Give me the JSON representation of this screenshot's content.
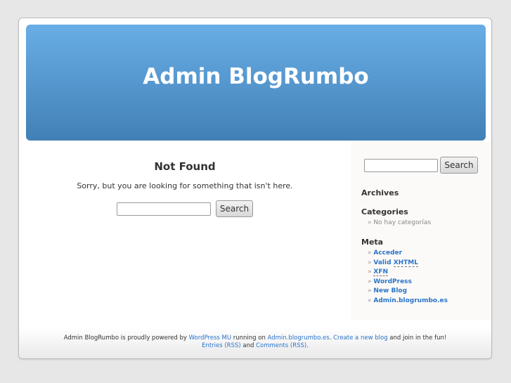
{
  "header": {
    "title": "Admin BlogRumbo"
  },
  "content": {
    "heading": "Not Found",
    "message": "Sorry, but you are looking for something that isn't here.",
    "search_value": "",
    "search_button": "Search"
  },
  "sidebar": {
    "search_value": "",
    "search_button": "Search",
    "archives_heading": "Archives",
    "categories_heading": "Categories",
    "no_categories": "No hay categorías",
    "meta_heading": "Meta",
    "meta": {
      "login": "Acceder",
      "valid": "Valid",
      "xhtml": "XHTML",
      "xfn": "XFN",
      "wordpress": "WordPress",
      "new_blog": "New Blog",
      "site": "Admin.blogrumbo.es"
    }
  },
  "footer": {
    "t1": "Admin BlogRumbo is proudly powered by ",
    "wpmu": "WordPress MU",
    "t2": " running on ",
    "site": "Admin.blogrumbo.es",
    "t3": ". ",
    "create": "Create a new blog",
    "t4": " and join in the fun!",
    "entries": "Entries (RSS)",
    "t5": " and ",
    "comments": "Comments (RSS)",
    "t6": "."
  }
}
